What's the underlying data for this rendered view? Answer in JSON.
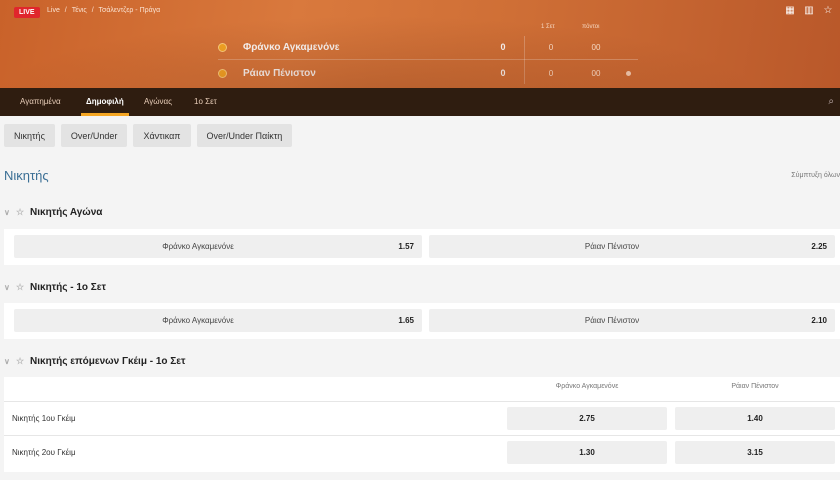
{
  "header": {
    "live_label": "LIVE",
    "breadcrumbs": [
      "Live",
      "/",
      "Τένις",
      "/",
      "Τσάλεντζερ - Πράγα"
    ]
  },
  "scoreboard": {
    "col_set": "1 Σετ",
    "col_points": "πόντοι",
    "players": [
      {
        "name": "Φράνκο Αγκαμενόνε",
        "score": "0",
        "set1": "0",
        "points": "00"
      },
      {
        "name": "Ράιαν Πένιστον",
        "score": "0",
        "set1": "0",
        "points": "00"
      }
    ]
  },
  "tabs": [
    {
      "label": "Αγαπημένα",
      "active": false
    },
    {
      "label": "Δημοφιλή",
      "active": true
    },
    {
      "label": "Αγώνας",
      "active": false
    },
    {
      "label": "1ο Σετ",
      "active": false
    }
  ],
  "chips": [
    "Νικητής",
    "Over/Under",
    "Χάντικαπ",
    "Over/Under Παίκτη"
  ],
  "section": {
    "title": "Νικητής",
    "collapse_all": "Σύμπτυξη όλων"
  },
  "markets": [
    {
      "title": "Νικητής Αγώνα",
      "odds": [
        {
          "name": "Φράνκο Αγκαμενόνε",
          "price": "1.57"
        },
        {
          "name": "Ράιαν Πένιστον",
          "price": "2.25"
        }
      ]
    },
    {
      "title": "Νικητής - 1ο Σετ",
      "odds": [
        {
          "name": "Φράνκο Αγκαμενόνε",
          "price": "1.65"
        },
        {
          "name": "Ράιαν Πένιστον",
          "price": "2.10"
        }
      ]
    }
  ],
  "next_game": {
    "title": "Νικητής επόμενων Γκέιμ - 1ο Σετ",
    "col1": "Φράνκο Αγκαμενόνε",
    "col2": "Ράιαν Πένιστον",
    "rows": [
      {
        "label": "Νικητής 1ου Γκέιμ",
        "p1": "2.75",
        "p2": "1.40"
      },
      {
        "label": "Νικητής 2ου Γκέιμ",
        "p1": "1.30",
        "p2": "3.15"
      }
    ]
  }
}
